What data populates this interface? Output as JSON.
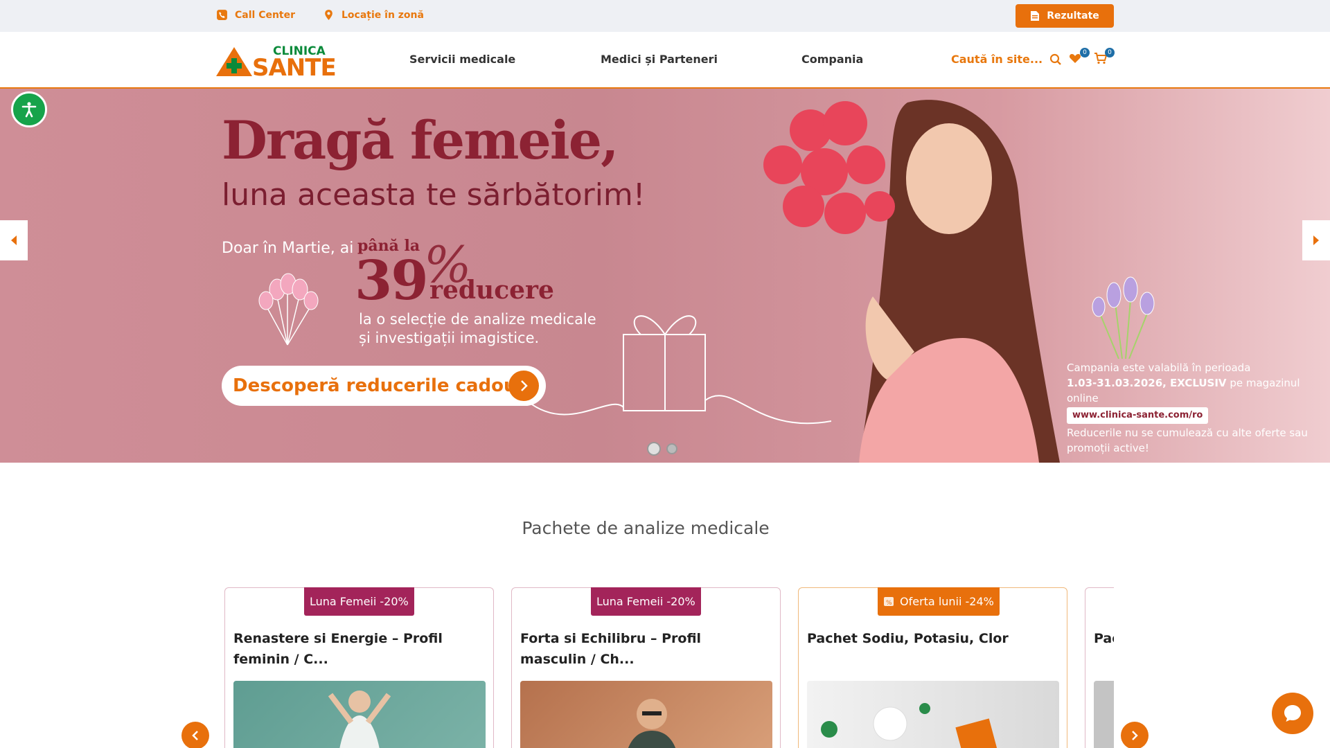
{
  "topbar": {
    "call_center": "Call Center",
    "location": "Locație în zonă",
    "results_button": "Rezultate"
  },
  "header": {
    "logo_text_top": "CLINICA",
    "logo_text_bottom": "SANTE",
    "nav": [
      "Servicii medicale",
      "Medici și Parteneri",
      "Compania"
    ],
    "search_label": "Caută în site...",
    "wishlist_count": "0",
    "cart_count": "0"
  },
  "hero": {
    "title": "Dragă femeie,",
    "subtitle": "luna aceasta te sărbătorim!",
    "march_text": "Doar în Martie, ai",
    "up_to": "până la",
    "discount_number": "39",
    "percent_sign": "%",
    "discount_word": "reducere",
    "desc_line1": "la o selecție de analize medicale",
    "desc_line2": "și investigații imagistice.",
    "cta_label": "Descoperă reducerile cadou",
    "terms_line1": "Campania este valabilă în perioada",
    "terms_dates": "1.03-31.03.2026, EXCLUSIV",
    "terms_online": "pe magazinul online",
    "terms_url": "www.clinica-sante.com/ro",
    "terms_note": "Reducerile nu se cumulează cu alte oferte sau promoții active!",
    "slide_count": 2,
    "active_slide": 1
  },
  "packages": {
    "title": "Pachete de analize medicale",
    "cards": [
      {
        "badge": "Luna Femeii -20%",
        "title": "Renastere si Energie – Profil feminin / C...",
        "badge_color": "#a3245a"
      },
      {
        "badge": "Luna Femeii -20%",
        "title": "Forta si Echilibru – Profil masculin / Ch...",
        "badge_color": "#a3245a"
      },
      {
        "badge": "Oferta lunii  -24%",
        "title": "Pachet Sodiu, Potasiu, Clor",
        "badge_color": "#e8700c"
      },
      {
        "badge": "",
        "title": "Pac",
        "badge_color": "#a3245a"
      }
    ]
  },
  "colors": {
    "accent": "#e8700c",
    "brand_dark": "#8c2233",
    "hero_bg": "#c88790",
    "badge_pink": "#a3245a",
    "a11y_green": "#16a34a"
  },
  "icons": [
    "phone-icon",
    "location-pin-icon",
    "document-icon",
    "search-icon",
    "heart-icon",
    "cart-icon",
    "accessibility-icon",
    "chevron-left-icon",
    "chevron-right-icon",
    "chat-icon"
  ]
}
